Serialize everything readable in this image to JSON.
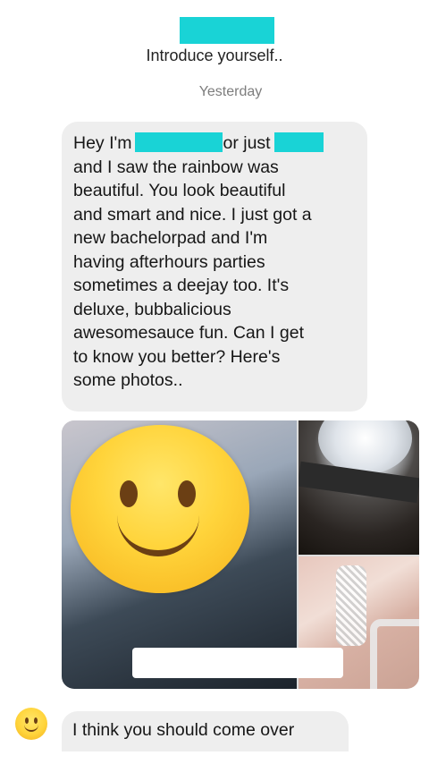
{
  "header": {
    "title": "Introduce yourself.."
  },
  "thread": {
    "timestamp": "Yesterday",
    "message1": {
      "lines": [
        {
          "before": "Hey I'm",
          "middle": "or just",
          "after": ""
        },
        "and I saw the rainbow was",
        "beautiful. You look beautiful",
        "and smart and nice. I just got a",
        "new bachelorpad and I'm",
        "having afterhours parties",
        "sometimes a deejay too. It's",
        "deluxe, bubbalicious",
        "awesomesauce fun. Can I get",
        "to know you better? Here's",
        "some photos.."
      ]
    },
    "message2": "I think you should come over"
  },
  "photos": {
    "main_icon": "slightly-smiling-face-emoji",
    "watch_icon": "watch-photo",
    "chain_icon": "chain-photo"
  },
  "avatar_icon": "slightly-smiling-face-emoji",
  "colors": {
    "redaction": "#19d3d6",
    "bubble": "#eeeeee",
    "timestamp": "#7d7d7d"
  }
}
